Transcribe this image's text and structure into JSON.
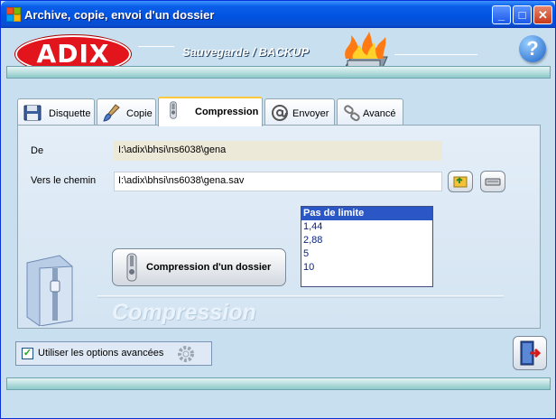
{
  "window": {
    "title": "Archive, copie, envoi d'un dossier",
    "controls": {
      "minimize": "_",
      "maximize": "□",
      "close": "✕"
    }
  },
  "header": {
    "logo": "ADIX",
    "banner": "Sauvegarde / BACKUP",
    "help": "?"
  },
  "tabs": [
    {
      "label": "Disquette",
      "icon": "floppy-icon"
    },
    {
      "label": "Copie",
      "icon": "brush-icon"
    },
    {
      "label": "Compression",
      "icon": "zip-icon",
      "active": true
    },
    {
      "label": "Envoyer",
      "icon": "email-icon"
    },
    {
      "label": "Avancé",
      "icon": "chain-icon"
    }
  ],
  "form": {
    "from_label": "De",
    "from_value": "I:\\adix\\bhsi\\ns6038\\gena",
    "to_label": "Vers le chemin",
    "to_value": "I:\\adix\\bhsi\\ns6038\\gena.sav"
  },
  "limit_list": {
    "options": [
      "Pas de limite",
      "1,44",
      "2,88",
      "5",
      "10"
    ],
    "selected": "Pas de limite"
  },
  "compress_button": "Compression d'un dossier",
  "watermark": "Compression",
  "advanced": {
    "label": "Utiliser les options avancées",
    "checked": true
  },
  "colors": {
    "titlebar": "#0053e1",
    "logo_red": "#e2141c",
    "selected_option": "#2a56c6",
    "panel": "#d4e4f2"
  }
}
